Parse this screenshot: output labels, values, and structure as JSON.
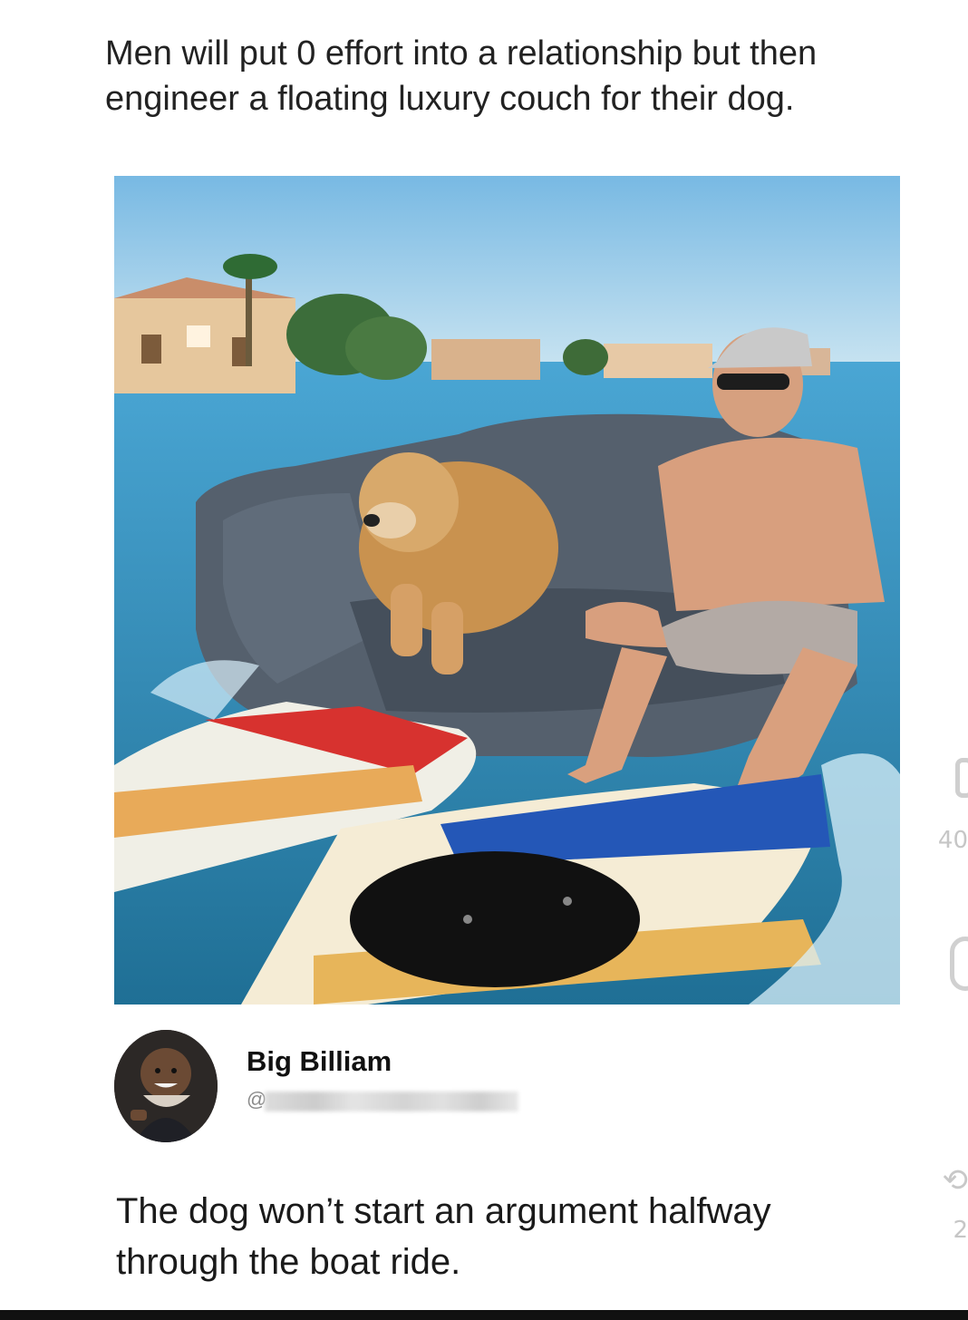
{
  "post": {
    "caption_line1": "Men will put 0 effort into a relationship but then",
    "caption_line2": "engineer a floating luxury couch for their dog."
  },
  "reply": {
    "author": "Big Billiam",
    "handle_prefix": "@",
    "text_line1": "The dog won’t start an argument halfway",
    "text_line2": "through the boat ride."
  },
  "edge_labels": {
    "count_1": "40",
    "count_2": "2"
  },
  "icons": [
    "comment-icon",
    "retweet-icon",
    "like-icon",
    "share-icon"
  ],
  "colors": {
    "background": "#ffffff",
    "text": "#1c1c1e",
    "water": "#3f8fb8",
    "sky": "#bfe0f0"
  }
}
